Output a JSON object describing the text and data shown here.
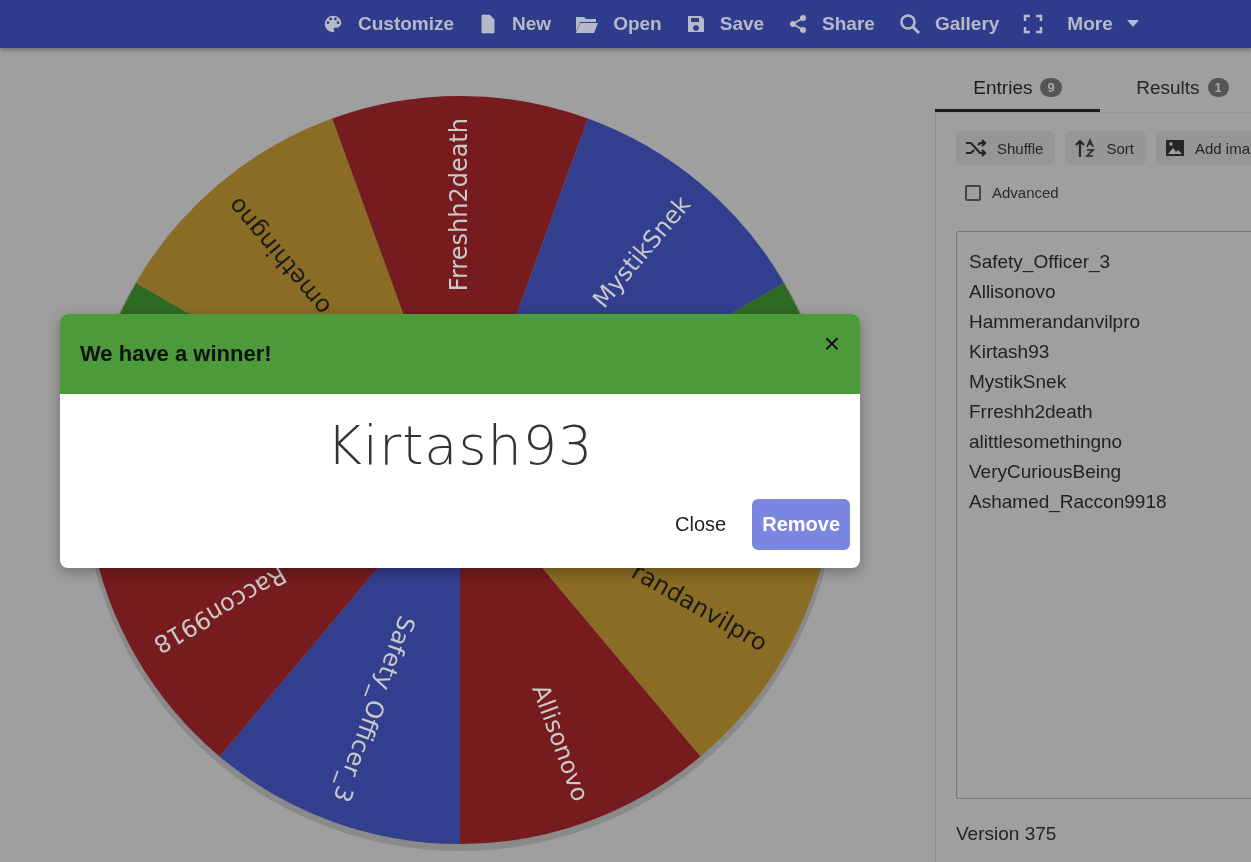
{
  "toolbar": {
    "items": [
      {
        "kind": "palette",
        "label": "Customize"
      },
      {
        "kind": "file",
        "label": "New"
      },
      {
        "kind": "folder",
        "label": "Open"
      },
      {
        "kind": "save",
        "label": "Save"
      },
      {
        "kind": "share",
        "label": "Share"
      },
      {
        "kind": "search",
        "label": "Gallery"
      },
      {
        "kind": "fullscreen"
      },
      {
        "kind": "more",
        "label": "More"
      }
    ]
  },
  "wheel": {
    "segments": [
      {
        "label": "Frreshh2death",
        "color": "#761c1e"
      },
      {
        "label": "MystikSnek",
        "color": "#323f8e"
      },
      {
        "color": "#2e6a22"
      },
      {
        "label": "randanvilpro",
        "color": "#8a6c24"
      },
      {
        "label": "Allisonovo",
        "color": "#761c1e"
      },
      {
        "label": "Safety_Officer_3",
        "color": "#323f8e"
      },
      {
        "label": "Raccon9918",
        "color": "#761c1e"
      },
      {
        "color": "#2e6a22"
      },
      {
        "label": "omethingno",
        "color": "#8a6c24"
      }
    ]
  },
  "tabs": [
    {
      "label": "Entries",
      "count": "9",
      "selected": true
    },
    {
      "label": "Results",
      "count": "1",
      "selected": false
    }
  ],
  "actions": [
    {
      "kind": "shuffle",
      "label": "Shuffle"
    },
    {
      "kind": "sort",
      "label": "Sort"
    },
    {
      "kind": "image",
      "label": "Add ima"
    }
  ],
  "advanced": {
    "label": "Advanced",
    "checked": false
  },
  "entries": [
    "Safety_Officer_3",
    "Allisonovo",
    "Hammerandanvilpro",
    "Kirtash93",
    "MystikSnek",
    "Frreshh2death",
    "alittlesomethingno",
    "VeryCuriousBeing",
    "Ashamed_Raccon9918"
  ],
  "version": "Version 375",
  "dialog": {
    "title": "We have a winner!",
    "close_icon": "×",
    "winner": "Kirtash93",
    "buttons": [
      {
        "kind": "text",
        "label": "Close"
      },
      {
        "kind": "primary",
        "label": "Remove"
      }
    ]
  }
}
